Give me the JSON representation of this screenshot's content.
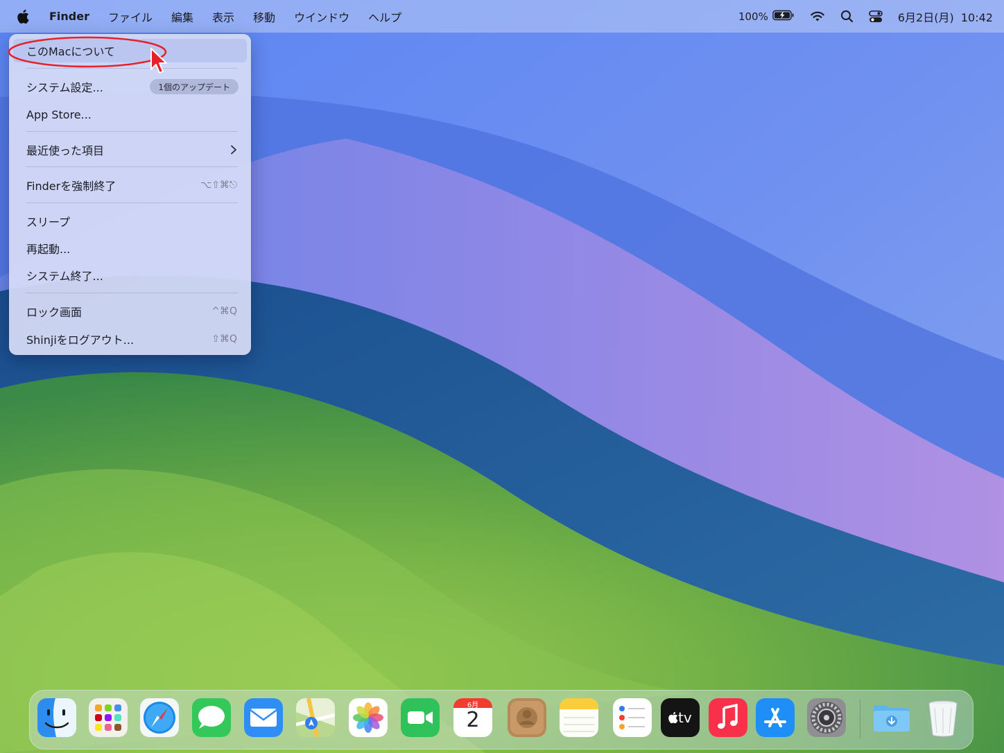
{
  "menubar": {
    "app_name": "Finder",
    "items": [
      "ファイル",
      "編集",
      "表示",
      "移動",
      "ウインドウ",
      "ヘルプ"
    ],
    "battery_percent": "100%",
    "datetime": "6月2日(月)  10:42"
  },
  "apple_menu": {
    "about": "このMacについて",
    "system_settings": "システム設定...",
    "update_badge": "1個のアップデート",
    "app_store": "App Store...",
    "recent_items": "最近使った項目",
    "force_quit": "Finderを強制終了",
    "force_quit_shortcut": "⌥⇧⌘⎋",
    "sleep": "スリープ",
    "restart": "再起動...",
    "shutdown": "システム終了...",
    "lock_screen": "ロック画面",
    "lock_screen_shortcut": "^⌘Q",
    "logout": "Shinjiをログアウト...",
    "logout_shortcut": "⇧⌘Q"
  },
  "dock": {
    "calendar_month": "6月",
    "calendar_day": "2",
    "tv_label": "tv",
    "apps": [
      "Finder",
      "Launchpad",
      "Safari",
      "Messages",
      "Mail",
      "Maps",
      "Photos",
      "FaceTime",
      "Calendar",
      "Contacts",
      "Notes",
      "Reminders",
      "TV",
      "Music",
      "App Store",
      "System Settings",
      "Downloads",
      "Trash"
    ]
  },
  "colors": {
    "annotation_red": "#e8202a",
    "menubar_bg": "#bccdf3",
    "menu_bg": "#d6dcf6"
  }
}
